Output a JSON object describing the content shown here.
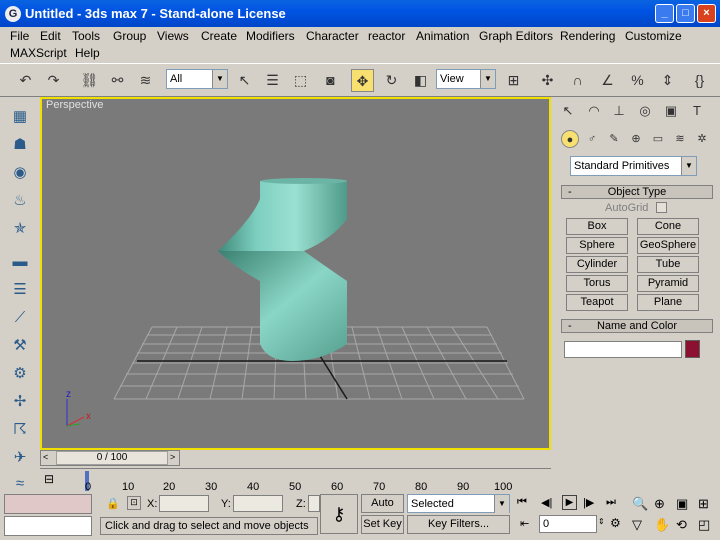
{
  "window": {
    "title": "Untitled  - 3ds max 7  - Stand-alone License",
    "min": "_",
    "max": "□",
    "close": "×"
  },
  "menu": {
    "row1": [
      "File",
      "Edit",
      "Tools",
      "Group",
      "Views",
      "Create",
      "Modifiers",
      "Character",
      "reactor",
      "Animation",
      "Graph Editors",
      "Rendering",
      "Customize"
    ],
    "row2": [
      "MAXScript",
      "Help"
    ]
  },
  "toolbar": {
    "selection_filter": "All",
    "ref_coord": "View"
  },
  "viewport": {
    "label": "Perspective",
    "axis_x": "x",
    "axis_z": "z"
  },
  "command_panel": {
    "category": "Standard Primitives",
    "object_type": {
      "title": "Object Type",
      "autogrid": "AutoGrid",
      "buttons": [
        "Box",
        "Cone",
        "Sphere",
        "GeoSphere",
        "Cylinder",
        "Tube",
        "Torus",
        "Pyramid",
        "Teapot",
        "Plane"
      ]
    },
    "name_color": {
      "title": "Name and Color",
      "name_value": "",
      "color": "#8c1030"
    }
  },
  "timeline": {
    "slider_label": "0 / 100",
    "ticks": [
      "0",
      "10",
      "20",
      "30",
      "40",
      "50",
      "60",
      "70",
      "80",
      "90",
      "100"
    ]
  },
  "status": {
    "x_label": "X:",
    "y_label": "Y:",
    "z_label": "Z:",
    "x_value": "",
    "y_value": "",
    "z_value": "",
    "prompt": "Click and drag to select and move objects",
    "auto_key": "Auto Key",
    "set_key": "Set Key",
    "key_mode": "Selected",
    "key_filters": "Key Filters...",
    "frame": "0"
  }
}
